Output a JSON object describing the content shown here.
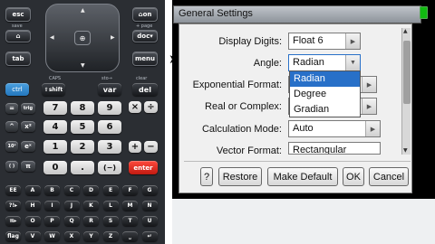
{
  "calculator": {
    "top_keys": {
      "esc": "esc",
      "save": "save",
      "tab": "tab",
      "home": "⌂on",
      "doc": "doc▾",
      "menu": "menu"
    },
    "top_labels": {
      "save": "save",
      "plus_page": "+ page",
      "context": "ctx"
    },
    "touchpad_center": "⊕",
    "row1": {
      "ctrl": "ctrl",
      "shift": "⇧shift",
      "var": "var",
      "del": "del",
      "caps": "CAPS",
      "sto": "sto→",
      "clear": "clear"
    },
    "fn_keys": [
      "=",
      "trig",
      "^",
      "x²",
      "10ˣ",
      "eˣ",
      "( )",
      "π"
    ],
    "num_rows": [
      [
        "7",
        "8",
        "9"
      ],
      [
        "4",
        "5",
        "6"
      ],
      [
        "1",
        "2",
        "3"
      ],
      [
        "0",
        ".",
        "(−)"
      ]
    ],
    "op_keys": [
      "×",
      "÷",
      "+",
      "−"
    ],
    "enter": "enter",
    "alpha_rows": [
      [
        "EE",
        "A",
        "B",
        "C",
        "D",
        "E",
        "F",
        "G"
      ],
      [
        "?!▸",
        "H",
        "I",
        "J",
        "K",
        "L",
        "M",
        "N"
      ],
      [
        "π▸",
        "O",
        "P",
        "Q",
        "R",
        "S",
        "T",
        "U"
      ],
      [
        "flag",
        "V",
        "W",
        "X",
        "Y",
        "Z",
        "⎵",
        "↵"
      ]
    ]
  },
  "dialog": {
    "title": "General Settings",
    "rows": [
      {
        "label": "Display Digits:",
        "value": "Float 6"
      },
      {
        "label": "Angle:",
        "value": "Radian"
      },
      {
        "label": "Exponential Format:",
        "value": ""
      },
      {
        "label": "Real or Complex:",
        "value": ""
      },
      {
        "label": "Calculation Mode:",
        "value": "Auto"
      },
      {
        "label": "Vector Format:",
        "value": "Rectangular"
      }
    ],
    "angle_options": [
      "Radian",
      "Degree",
      "Gradian"
    ],
    "angle_selected": "Radian",
    "buttons": {
      "help": "?",
      "restore": "Restore",
      "make_default": "Make Default",
      "ok": "OK",
      "cancel": "Cancel"
    }
  },
  "colors": {
    "selection": "#2870c8",
    "enter_key": "#e02a1f",
    "ctrl_key": "#3a8fd6"
  }
}
